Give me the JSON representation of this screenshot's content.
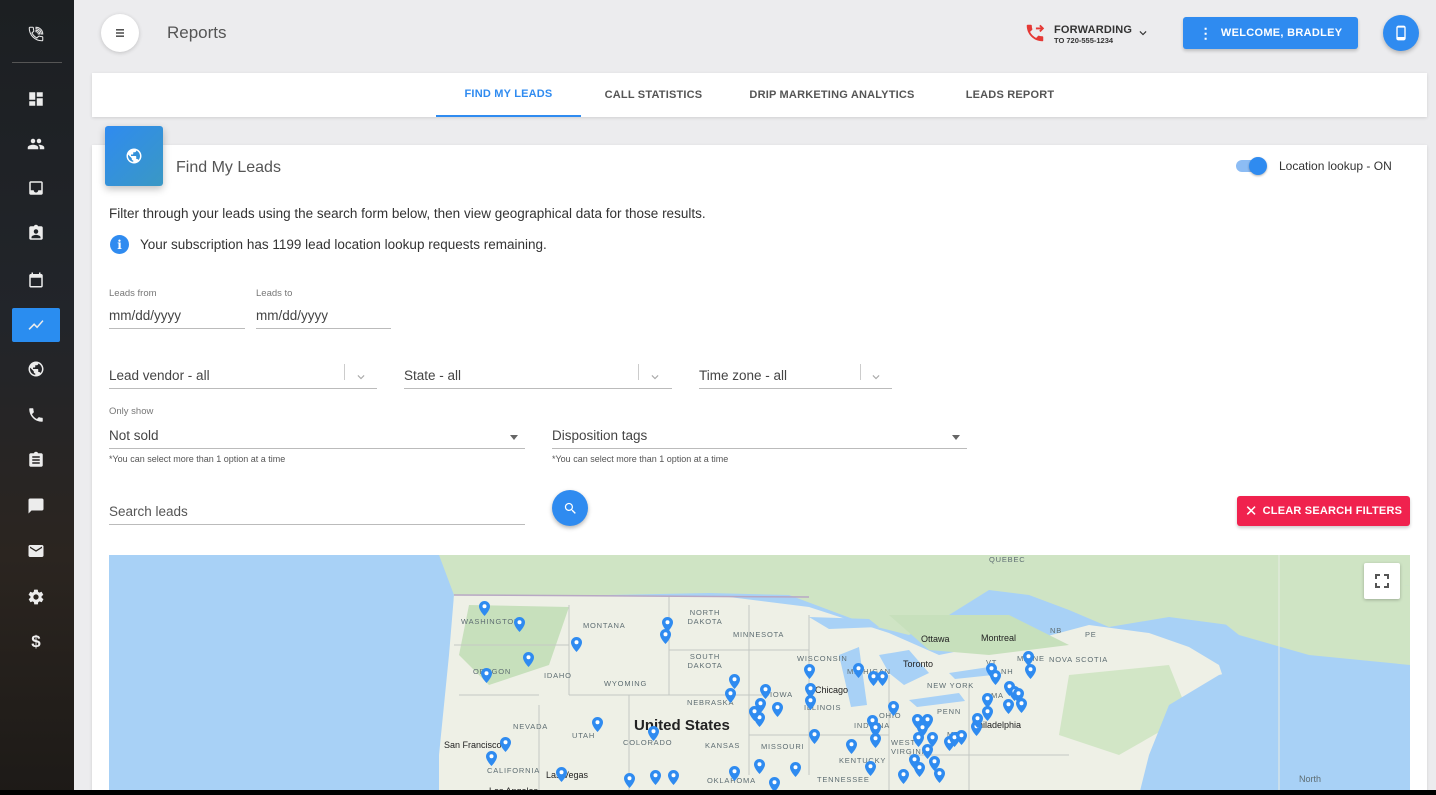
{
  "header": {
    "title": "Reports",
    "forwarding_label": "FORWARDING",
    "forwarding_number": "TO 720-555-1234",
    "welcome_label": "WELCOME, BRADLEY"
  },
  "tabs": [
    {
      "label": "FIND MY LEADS",
      "active": true
    },
    {
      "label": "CALL STATISTICS",
      "active": false
    },
    {
      "label": "DRIP MARKETING ANALYTICS",
      "active": false
    },
    {
      "label": "LEADS REPORT",
      "active": false
    }
  ],
  "sidebar": {
    "items": [
      {
        "icon": "phone-settings-icon"
      },
      {
        "icon": "dashboard-icon"
      },
      {
        "icon": "people-icon"
      },
      {
        "icon": "inbox-icon"
      },
      {
        "icon": "contact-card-icon"
      },
      {
        "icon": "calendar-icon"
      },
      {
        "icon": "reports-chart-icon",
        "active": true
      },
      {
        "icon": "globe-icon"
      },
      {
        "icon": "phone-icon"
      },
      {
        "icon": "clipboard-icon"
      },
      {
        "icon": "chat-icon"
      },
      {
        "icon": "mail-icon"
      },
      {
        "icon": "settings-icon"
      },
      {
        "icon": "dollar-icon"
      }
    ]
  },
  "card": {
    "title": "Find My Leads",
    "toggle_label": "Location lookup - ON",
    "toggle_on": true,
    "intro": "Filter through your leads using the search form below, then view geographical data for those results.",
    "info": "Your subscription has 1199 lead location lookup requests remaining."
  },
  "form": {
    "leads_from_label": "Leads from",
    "leads_from_placeholder": "mm/dd/yyyy",
    "leads_to_label": "Leads to",
    "leads_to_placeholder": "mm/dd/yyyy",
    "lead_vendor": "Lead vendor - all",
    "state": "State - all",
    "time_zone": "Time zone - all",
    "only_show_label": "Only show",
    "only_show_value": "Not sold",
    "only_show_hint": "*You can select more than 1 option at a time",
    "disposition_tags": "Disposition tags",
    "disposition_hint": "*You can select more than 1 option at a time",
    "search_placeholder": "Search leads",
    "clear_label": "CLEAR SEARCH FILTERS"
  },
  "map": {
    "region_labels": [
      "WASHINGTON",
      "MONTANA",
      "NORTH DAKOTA",
      "MINNESOTA",
      "SOUTH DAKOTA",
      "WISCONSIN",
      "MICHIGAN",
      "OREGON",
      "IDAHO",
      "WYOMING",
      "NEBRASKA",
      "IOWA",
      "ILLINOIS",
      "INDIANA",
      "OHIO",
      "PENN",
      "NEVADA",
      "UTAH",
      "COLORADO",
      "KANSAS",
      "MISSOURI",
      "KENTUCKY",
      "WEST VIRGINIA",
      "CALIFORNIA",
      "OKLAHOMA",
      "TENNESSEE",
      "NEW YORK",
      "MAINE",
      "NB",
      "PE",
      "NOVA SCOTIA",
      "QUEBEC",
      "VT",
      "NH",
      "MA",
      "MD"
    ],
    "city_labels": [
      "Ottawa",
      "Montreal",
      "Toronto",
      "Chicago",
      "Philadelphia",
      "San Francisco",
      "Las Vegas",
      "Los Angeles"
    ],
    "country_label": "United States",
    "ocean_label": "North",
    "pin_color": "#2f8bf0"
  },
  "colors": {
    "primary": "#2f8bf0",
    "danger": "#f0224e",
    "forwarding": "#e53935"
  }
}
